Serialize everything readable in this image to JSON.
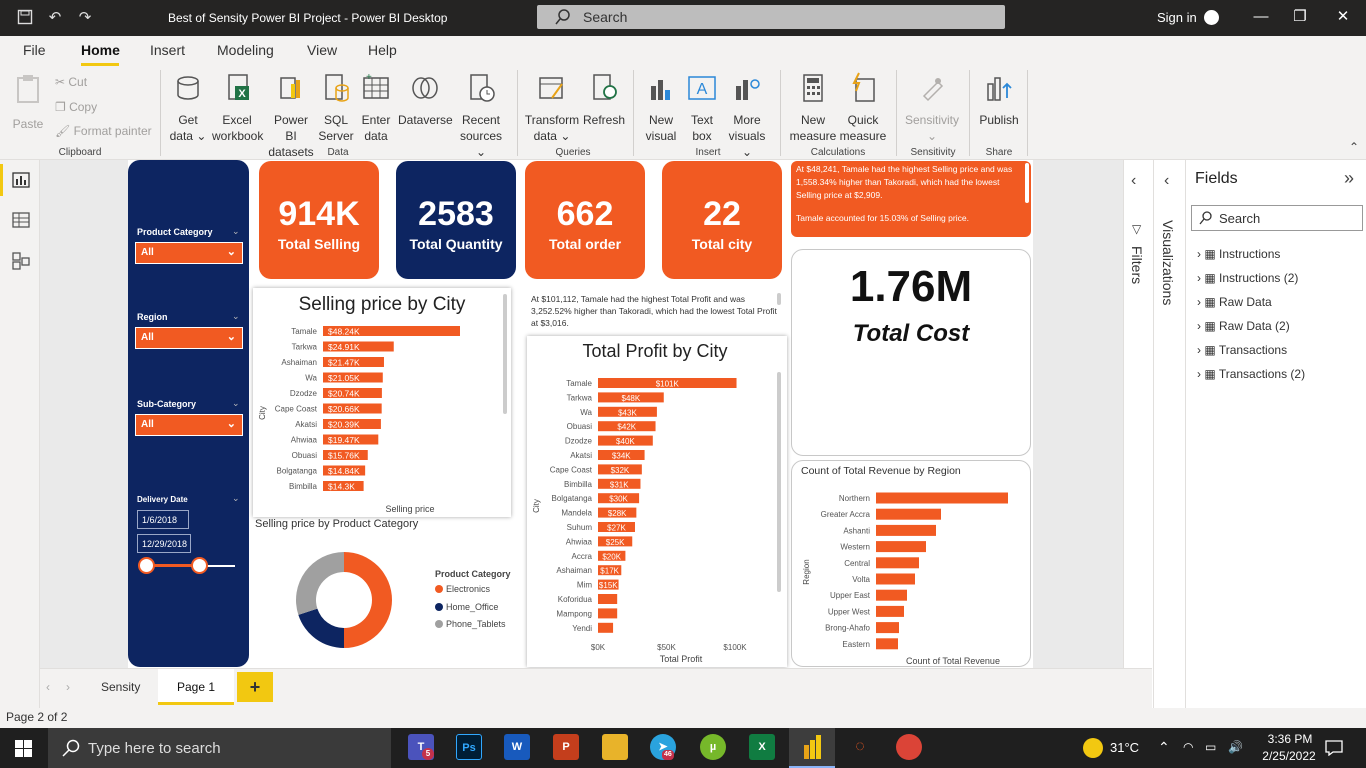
{
  "window": {
    "title": "Best of Sensity Power BI Project - Power BI Desktop",
    "search_placeholder": "Search",
    "sign_in": "Sign in"
  },
  "menu": {
    "tabs": [
      "File",
      "Home",
      "Insert",
      "Modeling",
      "View",
      "Help"
    ]
  },
  "ribbon": {
    "paste": "Paste",
    "cut": "Cut",
    "copy": "Copy",
    "format_painter": "Format painter",
    "get_data": [
      "Get",
      "data ⌄"
    ],
    "excel": [
      "Excel",
      "workbook"
    ],
    "powerbi_datasets": [
      "Power BI",
      "datasets"
    ],
    "sql": [
      "SQL",
      "Server"
    ],
    "enter_data": [
      "Enter",
      "data"
    ],
    "dataverse": "Dataverse",
    "recent_sources": [
      "Recent",
      "sources ⌄"
    ],
    "transform": [
      "Transform",
      "data ⌄"
    ],
    "refresh": "Refresh",
    "new_visual": [
      "New",
      "visual"
    ],
    "text_box": [
      "Text",
      "box"
    ],
    "more_visuals": [
      "More",
      "visuals ⌄"
    ],
    "new_measure": [
      "New",
      "measure"
    ],
    "quick_measure": [
      "Quick",
      "measure"
    ],
    "sensitivity": "Sensitivity",
    "publish": "Publish",
    "groups": {
      "clipboard": "Clipboard",
      "data": "Data",
      "queries": "Queries",
      "insert": "Insert",
      "calculations": "Calculations",
      "sensitivity": "Sensitivity",
      "share": "Share"
    }
  },
  "slicers": {
    "product_category": {
      "label": "Product Category",
      "value": "All"
    },
    "region": {
      "label": "Region",
      "value": "All"
    },
    "sub_category": {
      "label": "Sub-Category",
      "value": "All"
    },
    "delivery_date": {
      "label": "Delivery Date",
      "start": "1/6/2018",
      "end": "12/29/2018",
      "range": [
        0,
        1
      ]
    }
  },
  "kpis": [
    {
      "value": "914K",
      "label": "Total Selling"
    },
    {
      "value": "2583",
      "label": "Total Quantity"
    },
    {
      "value": "662",
      "label": "Total order"
    },
    {
      "value": "22",
      "label": "Total city"
    }
  ],
  "insight_top": {
    "line1": "At $48,241, Tamale had the highest Selling price and was 1,558.34% higher than Takoradi, which had the lowest Selling price at $2,909.",
    "line2": "Tamale accounted for 15.03% of Selling price."
  },
  "total_cost": {
    "value": "1.76M",
    "label": "Total Cost"
  },
  "profit_insight": "At $101,112, Tamale had the highest Total Profit and was 3,252.52% higher than Takoradi, which had the lowest Total Profit at $3,016.",
  "colors": {
    "orange": "#f15a22",
    "navy": "#0d2561",
    "accent_yellow": "#f2c811",
    "gray": "#a0a0a0"
  },
  "chart_data": [
    {
      "type": "bar",
      "orientation": "horizontal",
      "title": "Selling price by City",
      "xlabel": "Selling price",
      "ylabel": "City",
      "categories": [
        "Tamale",
        "Tarkwa",
        "Ashaiman",
        "Wa",
        "Dzodze",
        "Cape Coast",
        "Akatsi",
        "Ahwiaa",
        "Obuasi",
        "Bolgatanga",
        "Bimbilla"
      ],
      "values": [
        48240,
        24910,
        21470,
        21050,
        20740,
        20660,
        20390,
        19470,
        15760,
        14840,
        14300
      ],
      "data_labels": [
        "$48.24K",
        "$24.91K",
        "$21.47K",
        "$21.05K",
        "$20.74K",
        "$20.66K",
        "$20.39K",
        "$19.47K",
        "$15.76K",
        "$14.84K",
        "$14.3K"
      ]
    },
    {
      "type": "bar",
      "orientation": "horizontal",
      "title": "Total Profit by City",
      "xlabel": "Total Profit",
      "ylabel": "City",
      "xlim": [
        0,
        100000
      ],
      "xticks": [
        "$0K",
        "$50K",
        "$100K"
      ],
      "categories": [
        "Tamale",
        "Tarkwa",
        "Wa",
        "Obuasi",
        "Dzodze",
        "Akatsi",
        "Cape Coast",
        "Bimbilla",
        "Bolgatanga",
        "Mandela",
        "Suhum",
        "Ahwiaa",
        "Accra",
        "Ashaiman",
        "Mim",
        "Koforidua",
        "Mampong",
        "Yendi"
      ],
      "values": [
        101112,
        48000,
        43000,
        42000,
        40000,
        34000,
        32000,
        31000,
        30000,
        28000,
        27000,
        25000,
        20000,
        17000,
        15000,
        14000,
        14000,
        11000
      ],
      "data_labels": [
        "$101K",
        "$48K",
        "$43K",
        "$42K",
        "$40K",
        "$34K",
        "$32K",
        "$31K",
        "$30K",
        "$28K",
        "$27K",
        "$25K",
        "$20K",
        "$17K",
        "$15K",
        "",
        "",
        ""
      ]
    },
    {
      "type": "pie",
      "donut": true,
      "title": "Selling price by Product Category",
      "legend_title": "Product Category",
      "categories": [
        "Electronics",
        "Home_Office",
        "Phone_Tablets"
      ],
      "values": [
        50,
        20,
        30
      ],
      "colors": [
        "#f15a22",
        "#0d2561",
        "#a0a0a0"
      ]
    },
    {
      "type": "bar",
      "orientation": "horizontal",
      "title": "Count of Total Revenue by Region",
      "xlabel": "Count of Total Revenue",
      "ylabel": "Region",
      "categories": [
        "Northern",
        "Greater Accra",
        "Ashanti",
        "Western",
        "Central",
        "Volta",
        "Upper East",
        "Upper West",
        "Brong-Ahafo",
        "Eastern"
      ],
      "values": [
        132,
        65,
        60,
        50,
        43,
        39,
        31,
        28,
        23,
        22
      ]
    }
  ],
  "right_panes": {
    "filters": "Filters",
    "visualizations": "Visualizations",
    "fields_title": "Fields",
    "fields_search": "Search"
  },
  "fields": [
    "Instructions",
    "Instructions (2)",
    "Raw Data",
    "Raw Data (2)",
    "Transactions",
    "Transactions (2)"
  ],
  "pages": {
    "tabs": [
      "Sensity",
      "Page 1"
    ],
    "add": "+"
  },
  "status": "Page 2 of 2",
  "taskbar": {
    "search": "Type here to search",
    "temp": "31°C",
    "time": "3:36 PM",
    "date": "2/25/2022",
    "badge_teams": "5",
    "badge_telegram": "46"
  }
}
